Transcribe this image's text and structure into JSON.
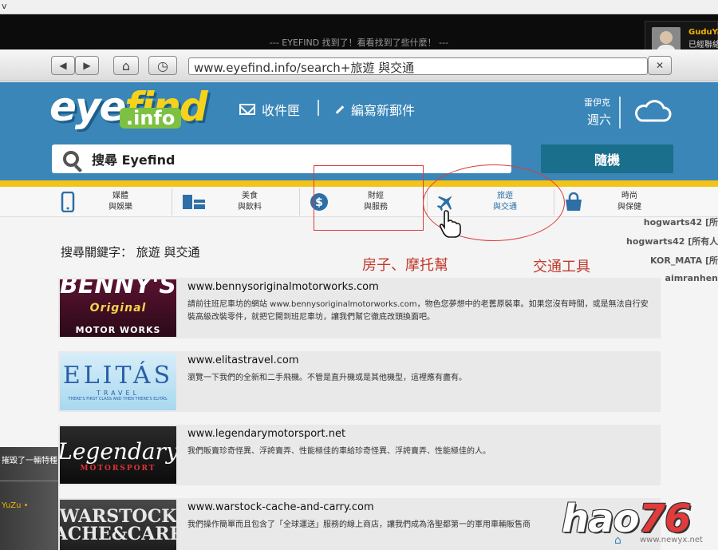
{
  "top_strip": {
    "label": "v"
  },
  "game_bar": {
    "title": "--- EYEFIND 找到了！看看找到了些什麼！ ---"
  },
  "notification": {
    "name": "GuduYa",
    "message": "已經聯絡"
  },
  "toolbar": {
    "back": "◀",
    "forward": "▶",
    "home": "⌂",
    "history": "◷",
    "url": "www.eyefind.info/search+旅遊 與交通",
    "close": "✕"
  },
  "site": {
    "logo_eye": "eye",
    "logo_find": "find",
    "logo_info": ".info",
    "inbox": "收件匣",
    "compose": "編寫新郵件",
    "weather_city": "雷伊克",
    "weather_day": "週六",
    "search_label": "搜尋 Eyefind",
    "random_button": "隨機"
  },
  "categories": [
    {
      "icon": "phone-icon",
      "line1": "媒體",
      "line2": "與娛樂"
    },
    {
      "icon": "food-icon",
      "line1": "美食",
      "line2": "與飲料"
    },
    {
      "icon": "dollar-icon",
      "line1": "財經",
      "line2": "與服務"
    },
    {
      "icon": "plane-icon",
      "line1": "旅遊",
      "line2": "與交通",
      "active": true
    },
    {
      "icon": "bag-icon",
      "line1": "時尚",
      "line2": "與保健"
    }
  ],
  "annotations": {
    "note_left": "房子、摩托幫",
    "note_right": "交通工具",
    "color": "#e03a3a"
  },
  "keyword_title": "搜尋關鍵字： 旅遊 與交通",
  "results": [
    {
      "url": "www.bennysoriginalmotorworks.com",
      "desc": "請前往班尼車坊的網站 www.bennysoriginalmotorworks.com，物色您夢想中的老舊原裝車。如果您沒有時間，或是無法自行安裝高級改裝零件，就把它開到班尼車坊，讓我們幫它徹底改頭換面吧。",
      "thumb_main": "BENNY'S",
      "thumb_mid": "Original",
      "thumb_sub": "MOTOR WORKS"
    },
    {
      "url": "www.elitastravel.com",
      "desc": "瀏覽一下我們的全新和二手飛機。不管是直升機或是其他機型，這裡應有盡有。",
      "thumb_main": "ELITÁS",
      "thumb_mid": "TRAVEL",
      "thumb_sub": "THERE'S FIRST CLASS AND THEN THERE'S ELITÁS."
    },
    {
      "url": "www.legendarymotorsport.net",
      "desc": "我們販賣珍奇怪異、浮誇賣弄、性能極佳的車給珍奇怪異、浮誇賣弄、性能極佳的人。",
      "thumb_main": "Legendary",
      "thumb_sub": "MOTORSPORT"
    },
    {
      "url": "www.warstock-cache-and-carry.com",
      "desc": "我們操作簡單而且包含了「全球運送」服務的線上商店，讓我們成為洛聖都第一的軍用車輛販售商",
      "thumb_main": "WARSTOCK",
      "thumb_sub": "CACHE&CARRY"
    }
  ],
  "right_overlay": [
    "hogwarts42 [所",
    "hogwarts42 [所有人] i c",
    "KOR_MATA [所",
    "aimranhen"
  ],
  "left_overlay": {
    "line1": "摧毀了一輛特種",
    "line2": "YuZu •"
  },
  "watermark": {
    "brand": "hao",
    "num": "76",
    "site": "www.newyx.net"
  },
  "colors": {
    "header_blue": "#3a86b8",
    "stripe_yellow": "#f2c318",
    "random_button": "#1a6f8c"
  }
}
